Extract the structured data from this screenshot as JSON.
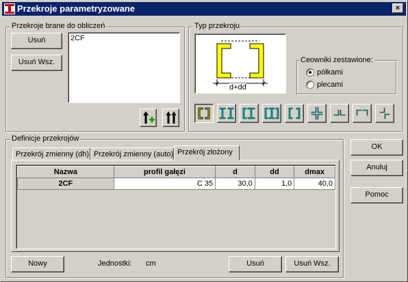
{
  "window": {
    "title": "Przekroje parametryzowane",
    "close_label": "×"
  },
  "left_group": {
    "legend": "Przekroje brane do obliczeń",
    "remove_label": "Usuń",
    "remove_all_label": "Usuń Wsz.",
    "list_items": [
      "2CF"
    ]
  },
  "type_group": {
    "legend": "Typ przekroju",
    "dimension_label": "d+dd",
    "ceowniki": {
      "legend": "Ceowniki zestawione:",
      "options": [
        "półkami",
        "plecami"
      ],
      "selected": "półkami"
    },
    "icons": [
      "c-inward-icon",
      "double-i-icon",
      "i-in-c-icon",
      "i-channels-icon",
      "c-outward-icon",
      "cross-tees-icon",
      "double-tee-icon",
      "angles-icon",
      "z-angles-icon"
    ]
  },
  "defs_group": {
    "legend": "Definicje przekrojów",
    "tabs": [
      "Przekrój zmienny (dh)",
      "Przekrój zmienny (auto)",
      "Przekrój złożony"
    ],
    "active_tab": "Przekrój złożony",
    "table": {
      "headers": [
        "Nazwa",
        "profil gałęzi",
        "d",
        "dd",
        "dmax"
      ],
      "rows": [
        {
          "name": "2CF",
          "profil": "C 35",
          "d": "30,0",
          "dd": "1,0",
          "dmax": "40,0"
        }
      ]
    },
    "new_label": "Nowy",
    "units_label": "Jednostki:",
    "units_value": "cm",
    "remove_label": "Usuń",
    "remove_all_label": "Usuń Wsz."
  },
  "side_buttons": {
    "ok_label": "OK",
    "cancel_label": "Anuluj",
    "help_label": "Pomoc"
  },
  "colors": {
    "titlebar": "#0a246a",
    "section_yellow": "#ffff00",
    "icon_teal": "#008080",
    "face": "#d4d0c8"
  }
}
